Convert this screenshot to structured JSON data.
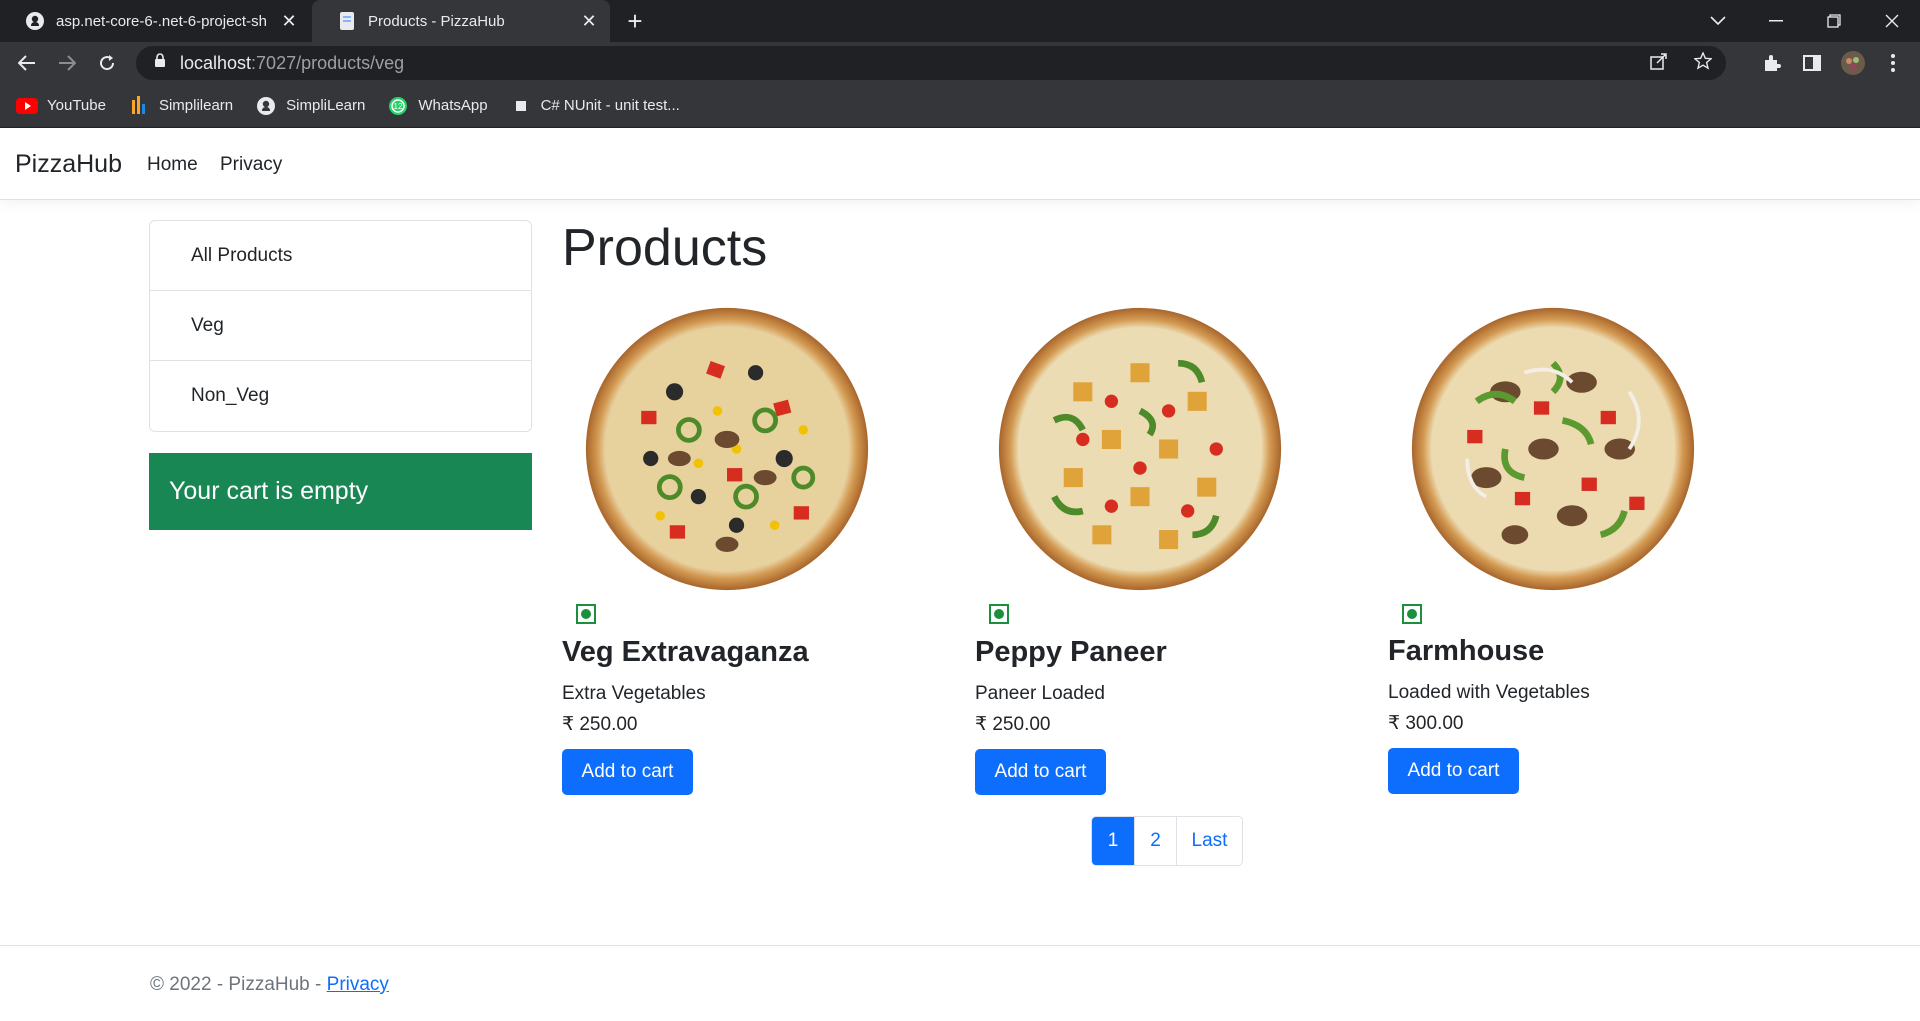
{
  "browser": {
    "tabs": [
      {
        "title": "asp.net-core-6-.net-6-project-sh",
        "active": false,
        "icon": "github-icon"
      },
      {
        "title": "Products - PizzaHub",
        "active": true,
        "icon": "page-icon"
      }
    ],
    "address": {
      "host": "localhost",
      "path": ":7027/products/veg"
    },
    "bookmarks": [
      {
        "label": "YouTube",
        "icon": "youtube-icon"
      },
      {
        "label": "Simplilearn",
        "icon": "simplilearn-icon"
      },
      {
        "label": "SimpliLearn",
        "icon": "github-icon"
      },
      {
        "label": "WhatsApp",
        "icon": "whatsapp-icon"
      },
      {
        "label": "C# NUnit - unit test...",
        "icon": "page-icon"
      }
    ]
  },
  "site": {
    "brand": "PizzaHub",
    "nav": [
      "Home",
      "Privacy"
    ],
    "categories": [
      "All Products",
      "Veg",
      "Non_Veg"
    ],
    "cart_message": "Your cart is empty",
    "page_title": "Products",
    "products": [
      {
        "name": "Veg Extravaganza",
        "description": "Extra Vegetables",
        "price": "₹ 250.00",
        "button": "Add to cart",
        "veg": true
      },
      {
        "name": "Peppy Paneer",
        "description": "Paneer Loaded",
        "price": "₹ 250.00",
        "button": "Add to cart",
        "veg": true
      },
      {
        "name": "Farmhouse",
        "description": "Loaded with Vegetables",
        "price": "₹ 300.00",
        "button": "Add to cart",
        "veg": true
      }
    ],
    "pagination": {
      "pages": [
        "1",
        "2",
        "Last"
      ],
      "active": "1"
    },
    "footer": {
      "text": "© 2022 - PizzaHub - ",
      "link": "Privacy"
    }
  },
  "colors": {
    "primary": "#0d6efd",
    "success": "#198754",
    "veg": "#1a8f3c"
  }
}
